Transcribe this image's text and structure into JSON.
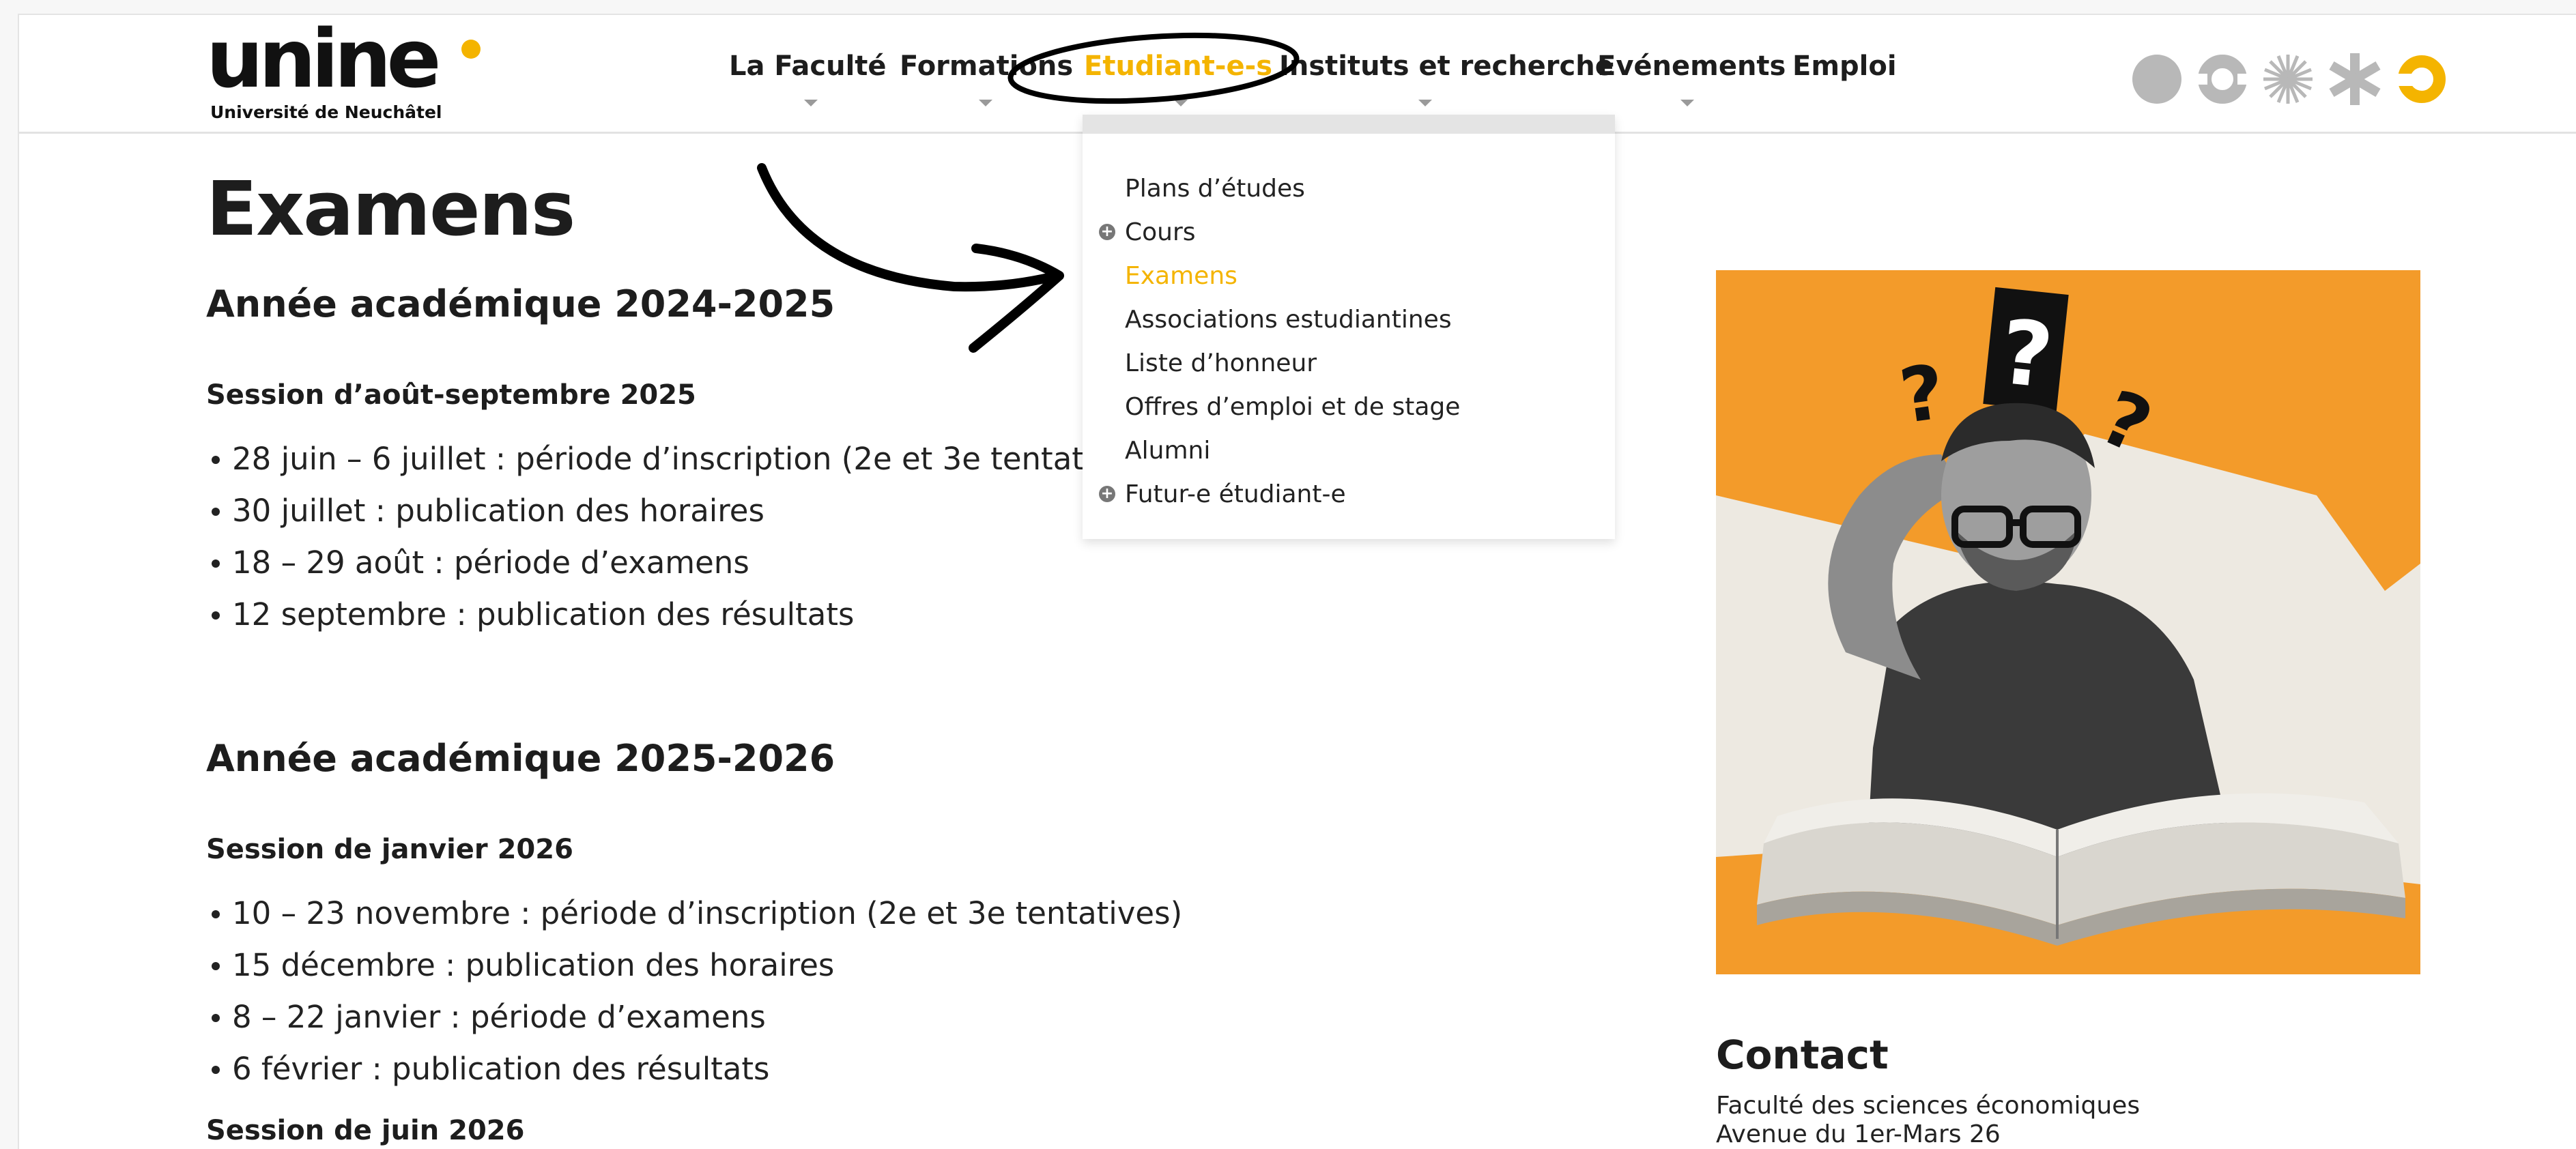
{
  "header": {
    "logo_text": "unine",
    "logo_subtitle": "Université de Neuchâtel",
    "nav": [
      {
        "label": "La Faculté",
        "has_dropdown": true
      },
      {
        "label": "Formations",
        "has_dropdown": true
      },
      {
        "label": "Etudiant-e-s",
        "has_dropdown": true,
        "active": true
      },
      {
        "label": "Instituts et recherche",
        "has_dropdown": true
      },
      {
        "label": "Evénements",
        "has_dropdown": true
      },
      {
        "label": "Emploi",
        "has_dropdown": false
      }
    ],
    "icons": [
      "circle-icon",
      "ring-icon",
      "sunburst-icon",
      "asterisk-icon",
      "yellow-ring-icon"
    ]
  },
  "dropdown": {
    "items": [
      {
        "label": "Plans d’études",
        "expandable": false,
        "active": false
      },
      {
        "label": "Cours",
        "expandable": true,
        "active": false
      },
      {
        "label": "Examens",
        "expandable": false,
        "active": true
      },
      {
        "label": "Associations estudiantines",
        "expandable": false,
        "active": false
      },
      {
        "label": "Liste d’honneur",
        "expandable": false,
        "active": false
      },
      {
        "label": "Offres d’emploi et de stage",
        "expandable": false,
        "active": false
      },
      {
        "label": "Alumni",
        "expandable": false,
        "active": false
      },
      {
        "label": "Futur-e étudiant-e",
        "expandable": true,
        "active": false
      }
    ]
  },
  "main": {
    "title": "Examens",
    "year1": {
      "heading": "Année académique 2024-2025",
      "session": "Session d’août-septembre 2025",
      "items": [
        "28 juin – 6 juillet : période d’inscription (2e et 3e tentat",
        "30 juillet : publication des horaires",
        "18 – 29 août : période d’examens",
        "12 septembre : publication des résultats"
      ]
    },
    "year2": {
      "heading": "Année académique 2025-2026",
      "session": "Session de janvier 2026",
      "items": [
        "10 – 23 novembre : période d’inscription (2e et 3e tentatives)",
        "15 décembre : publication des horaires",
        "8 – 22 janvier : période d’examens",
        "6 février : publication des résultats"
      ],
      "session2": "Session de juin 2026"
    }
  },
  "sidebar": {
    "illustration_question_mark": "?",
    "contact_title": "Contact",
    "contact_lines": [
      "Faculté des sciences économiques",
      "Avenue du 1er-Mars 26"
    ]
  },
  "colors": {
    "accent": "#f4b400",
    "orange_panel": "#f39b2a",
    "text": "#1d1d1d"
  }
}
